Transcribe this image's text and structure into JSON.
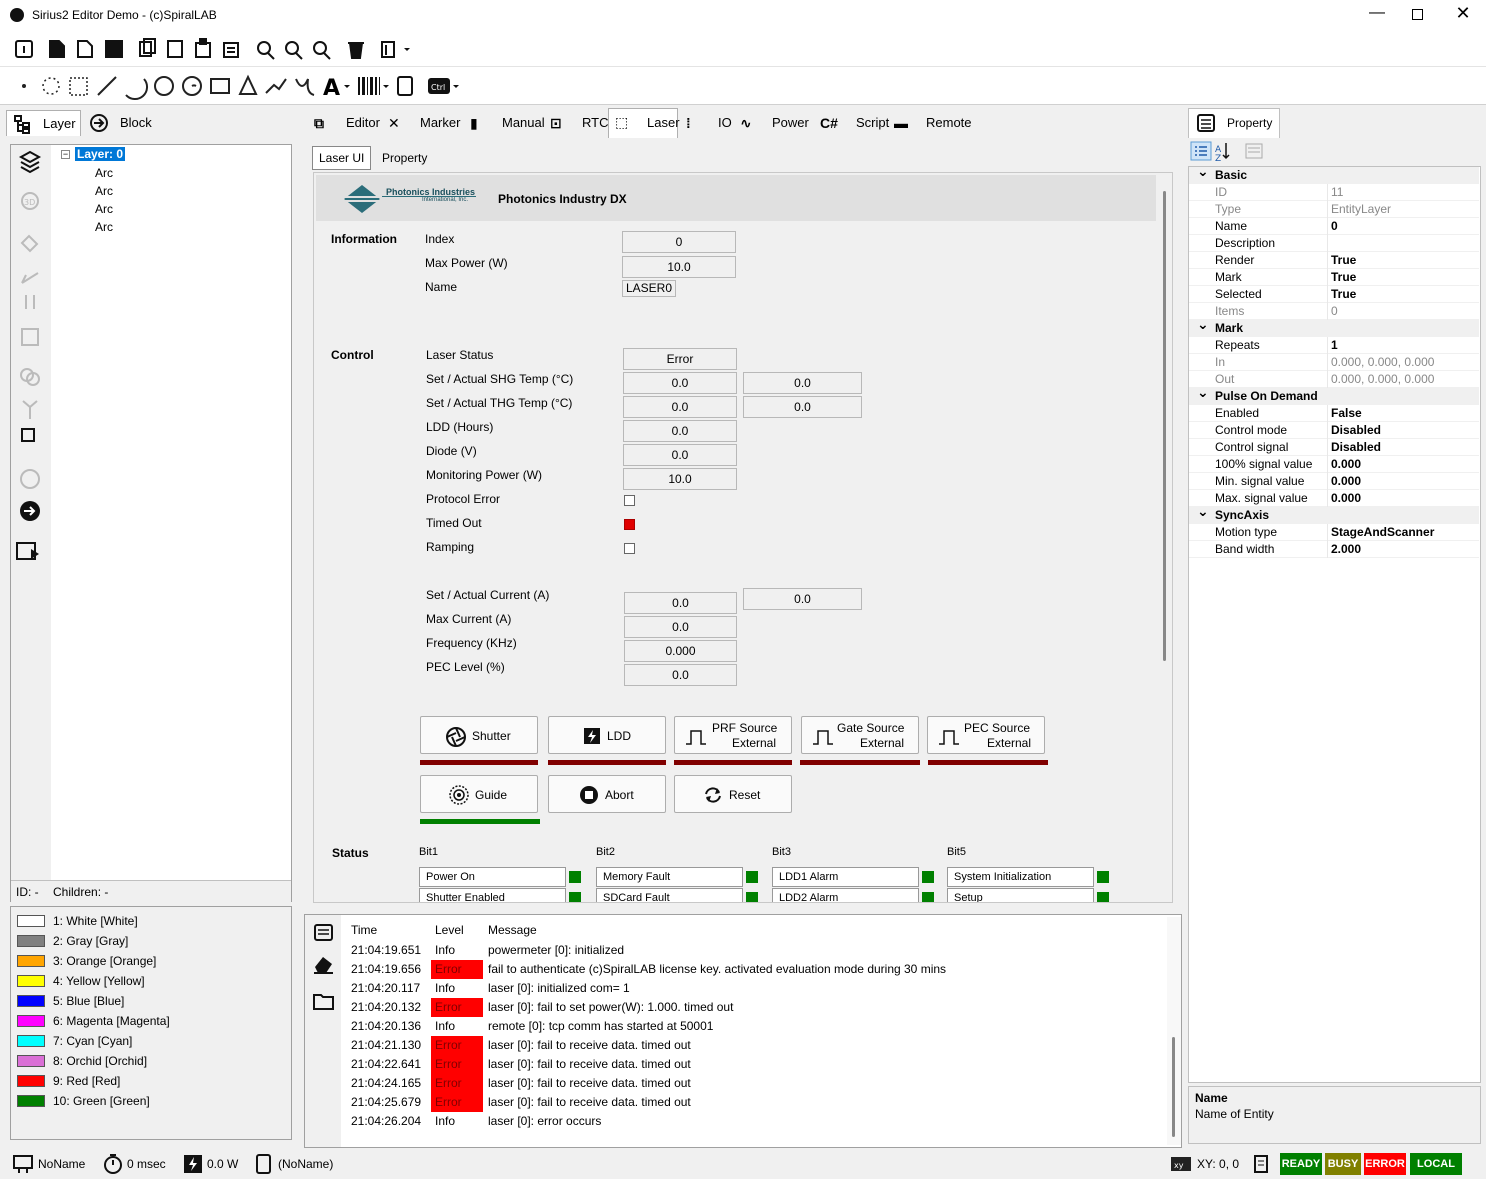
{
  "window": {
    "title": "Sirius2 Editor Demo - (c)SpiralLAB"
  },
  "left_tabs": [
    {
      "label": "Layer"
    },
    {
      "label": "Block"
    }
  ],
  "center_tabs": [
    {
      "label": "Editor"
    },
    {
      "label": "Marker"
    },
    {
      "label": "Manual"
    },
    {
      "label": "RTC"
    },
    {
      "label": "Laser"
    },
    {
      "label": "IO"
    },
    {
      "label": "Power"
    },
    {
      "label": "Script"
    },
    {
      "label": "Remote"
    }
  ],
  "tree": {
    "root": "Layer: 0",
    "children": [
      "Arc",
      "Arc",
      "Arc",
      "Arc"
    ]
  },
  "tree_footer": {
    "id": "ID: -",
    "children": "Children: -"
  },
  "pens": [
    {
      "label": "1: White [White]",
      "color": "#ffffff"
    },
    {
      "label": "2: Gray [Gray]",
      "color": "#808080"
    },
    {
      "label": "3: Orange [Orange]",
      "color": "#ffa500"
    },
    {
      "label": "4: Yellow [Yellow]",
      "color": "#ffff00"
    },
    {
      "label": "5: Blue [Blue]",
      "color": "#0000ff"
    },
    {
      "label": "6: Magenta [Magenta]",
      "color": "#ff00ff"
    },
    {
      "label": "7: Cyan [Cyan]",
      "color": "#00ffff"
    },
    {
      "label": "8: Orchid [Orchid]",
      "color": "#da70d6"
    },
    {
      "label": "9: Red [Red]",
      "color": "#ff0000"
    },
    {
      "label": "10: Green [Green]",
      "color": "#008000"
    }
  ],
  "laser_subtabs": [
    {
      "label": "Laser UI"
    },
    {
      "label": "Property"
    }
  ],
  "laser": {
    "logo_text": "Photonics Industries",
    "logo_sub": "International, Inc.",
    "model": "Photonics Industry DX",
    "information_label": "Information",
    "index_label": "Index",
    "index": "0",
    "maxpower_label": "Max Power (W)",
    "maxpower": "10.0",
    "name_label": "Name",
    "name": "LASER0",
    "control_label": "Control",
    "status_label_text": "Laser Status",
    "laser_status": "Error",
    "shg_label": "Set / Actual SHG Temp (°C)",
    "shg_set": "0.0",
    "shg_act": "0.0",
    "thg_label": "Set / Actual THG Temp (°C)",
    "thg_set": "0.0",
    "thg_act": "0.0",
    "ldd_label": "LDD (Hours)",
    "ldd": "0.0",
    "diode_label": "Diode (V)",
    "diode": "0.0",
    "monitor_label": "Monitoring Power (W)",
    "monitor": "10.0",
    "protocol_label": "Protocol Error",
    "timedout_label": "Timed Out",
    "ramping_label": "Ramping",
    "current_label": "Set / Actual Current (A)",
    "current_set": "0.0",
    "current_act": "0.0",
    "maxcurrent_label": "Max Current (A)",
    "maxcurrent": "0.0",
    "freq_label": "Frequency (KHz)",
    "freq": "0.000",
    "pec_label": "PEC Level  (%)",
    "pec": "0.0",
    "btn_shutter": "Shutter",
    "btn_ldd": "LDD",
    "btn_prf_1": "PRF Source",
    "btn_prf_2": "External",
    "btn_gate_1": "Gate Source",
    "btn_gate_2": "External",
    "btn_pec_1": "PEC Source",
    "btn_pec_2": "External",
    "btn_guide": "Guide",
    "btn_abort": "Abort",
    "btn_reset": "Reset",
    "status_section": "Status",
    "bits": [
      {
        "title": "Bit1",
        "items": [
          "Power On",
          "Shutter Enabled"
        ]
      },
      {
        "title": "Bit2",
        "items": [
          "Memory Fault",
          "SDCard Fault"
        ]
      },
      {
        "title": "Bit3",
        "items": [
          "LDD1 Alarm",
          "LDD2 Alarm"
        ]
      },
      {
        "title": "Bit5",
        "items": [
          "System Initialization",
          "Setup"
        ]
      }
    ]
  },
  "log": {
    "headers": {
      "time": "Time",
      "level": "Level",
      "message": "Message"
    },
    "rows": [
      {
        "time": "21:04:19.651",
        "level": "Info",
        "message": "powermeter [0]: initialized"
      },
      {
        "time": "21:04:19.656",
        "level": "Error",
        "message": "fail to authenticate (c)SpiralLAB license key. activated evaluation mode during 30 mins"
      },
      {
        "time": "21:04:20.117",
        "level": "Info",
        "message": "laser [0]: initialized com= 1"
      },
      {
        "time": "21:04:20.132",
        "level": "Error",
        "message": "laser [0]: fail to set power(W): 1.000. timed out"
      },
      {
        "time": "21:04:20.136",
        "level": "Info",
        "message": "remote [0]: tcp comm has started at 50001"
      },
      {
        "time": "21:04:21.130",
        "level": "Error",
        "message": "laser [0]: fail to receive data. timed out"
      },
      {
        "time": "21:04:22.641",
        "level": "Error",
        "message": "laser [0]: fail to receive data. timed out"
      },
      {
        "time": "21:04:24.165",
        "level": "Error",
        "message": "laser [0]: fail to receive data. timed out"
      },
      {
        "time": "21:04:25.679",
        "level": "Error",
        "message": "laser [0]: fail to receive data. timed out"
      },
      {
        "time": "21:04:26.204",
        "level": "Info",
        "message": "laser [0]: error occurs"
      }
    ]
  },
  "property_panel": {
    "tab": "Property",
    "groups": [
      {
        "title": "Basic",
        "props": [
          [
            "ID",
            "11",
            false
          ],
          [
            "Type",
            "EntityLayer",
            false
          ],
          [
            "Name",
            "0",
            true
          ],
          [
            "Description",
            "",
            true
          ],
          [
            "Render",
            "True",
            true
          ],
          [
            "Mark",
            "True",
            true
          ],
          [
            "Selected",
            "True",
            true
          ],
          [
            "Items",
            "0",
            false
          ]
        ]
      },
      {
        "title": "Mark",
        "props": [
          [
            "Repeats",
            "1",
            true
          ],
          [
            "In",
            "0.000, 0.000, 0.000",
            false
          ],
          [
            "Out",
            "0.000, 0.000, 0.000",
            false
          ]
        ]
      },
      {
        "title": "Pulse On Demand",
        "props": [
          [
            "Enabled",
            "False",
            true
          ],
          [
            "Control mode",
            "Disabled",
            true
          ],
          [
            "Control signal",
            "Disabled",
            true
          ],
          [
            "100% signal value",
            "0.000",
            true
          ],
          [
            "Min. signal value",
            "0.000",
            true
          ],
          [
            "Max. signal value",
            "0.000",
            true
          ]
        ]
      },
      {
        "title": "SyncAxis",
        "props": [
          [
            "Motion type",
            "StageAndScanner",
            true
          ],
          [
            "Band width",
            "2.000",
            true
          ]
        ]
      }
    ],
    "desc_title": "Name",
    "desc_text": "Name of Entity"
  },
  "statusbar": {
    "doc": "NoName",
    "time": "0 msec",
    "power": "0.0 W",
    "file": "(NoName)",
    "xy": "XY: 0, 0",
    "badges": [
      {
        "label": "READY",
        "color": "#008000"
      },
      {
        "label": "BUSY",
        "color": "#808000"
      },
      {
        "label": "ERROR",
        "color": "#ff0000"
      },
      {
        "label": "LOCAL",
        "color": "#008000"
      }
    ]
  }
}
